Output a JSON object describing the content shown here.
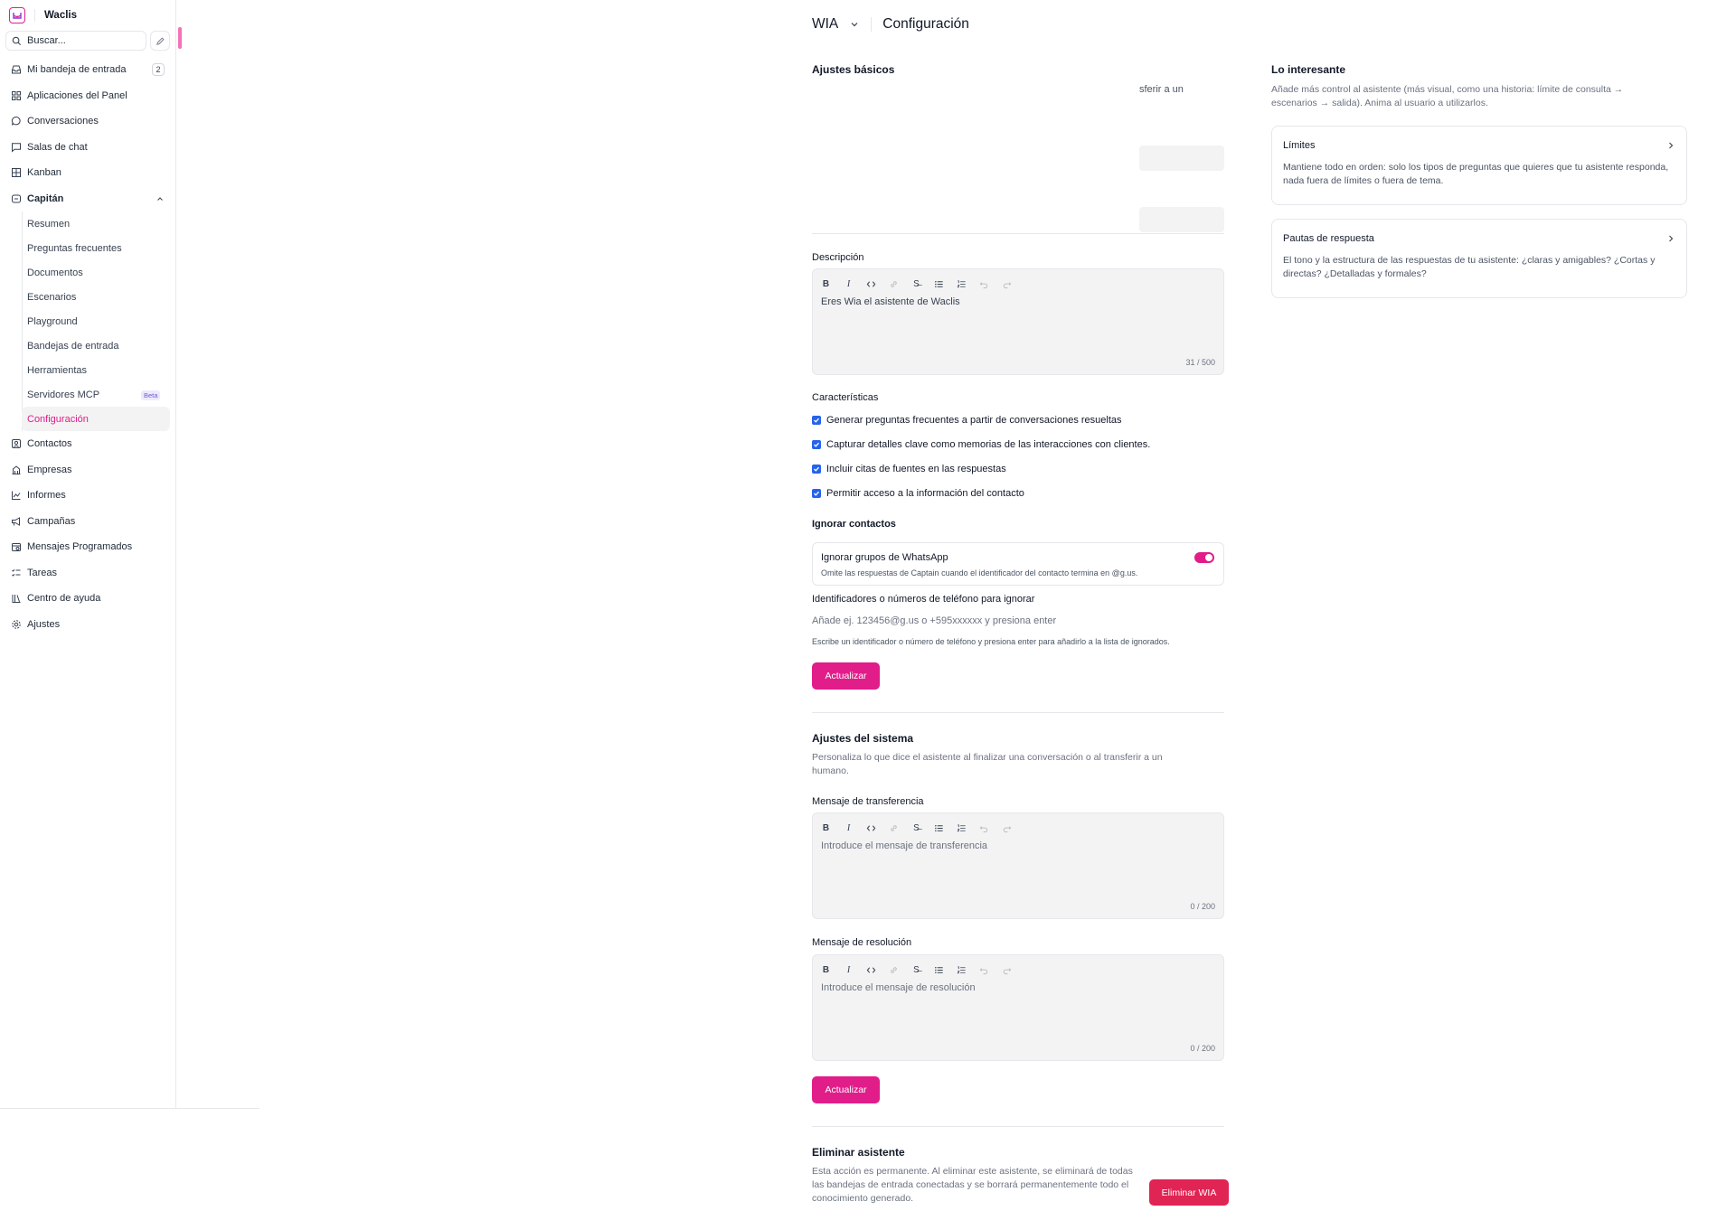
{
  "sidebar": {
    "account": "Waclis",
    "search_placeholder": "Buscar...",
    "nav": [
      {
        "label": "Mi bandeja de entrada",
        "icon": "inbox-icon",
        "badge": "2"
      },
      {
        "label": "Aplicaciones del Panel",
        "icon": "apps-icon"
      },
      {
        "label": "Conversaciones",
        "icon": "chat-bubble-icon"
      },
      {
        "label": "Salas de chat",
        "icon": "chat-square-icon"
      },
      {
        "label": "Kanban",
        "icon": "kanban-icon"
      },
      {
        "label": "Capitán",
        "icon": "captain-icon"
      }
    ],
    "captain_sub": [
      {
        "label": "Resumen"
      },
      {
        "label": "Preguntas frecuentes"
      },
      {
        "label": "Documentos"
      },
      {
        "label": "Escenarios"
      },
      {
        "label": "Playground"
      },
      {
        "label": "Bandejas de entrada"
      },
      {
        "label": "Herramientas"
      },
      {
        "label": "Servidores MCP",
        "badge": "Beta"
      },
      {
        "label": "Configuración",
        "active": true
      }
    ],
    "nav_bottom": [
      {
        "label": "Contactos",
        "icon": "contacts-icon"
      },
      {
        "label": "Empresas",
        "icon": "building-icon"
      },
      {
        "label": "Informes",
        "icon": "chart-icon"
      },
      {
        "label": "Campañas",
        "icon": "megaphone-icon"
      },
      {
        "label": "Mensajes Programados",
        "icon": "calendar-icon"
      },
      {
        "label": "Tareas",
        "icon": "tasks-icon"
      },
      {
        "label": "Centro de ayuda",
        "icon": "library-icon"
      },
      {
        "label": "Ajustes",
        "icon": "gear-icon"
      }
    ]
  },
  "header": {
    "assistant": "WIA",
    "title": "Configuración"
  },
  "basic": {
    "title": "Ajustes básicos",
    "stub_text": "sferir a un",
    "description_label": "Descripción",
    "description_value": "Eres Wia el asistente de Waclis",
    "description_count": "31 / 500"
  },
  "features": {
    "title": "Características",
    "items": [
      {
        "label": "Generar preguntas frecuentes a partir de conversaciones resueltas",
        "checked": true
      },
      {
        "label": "Capturar detalles clave como memorias de las interacciones con clientes.",
        "checked": true
      },
      {
        "label": "Incluir citas de fuentes en las respuestas",
        "checked": true
      },
      {
        "label": "Permitir acceso a la información del contacto",
        "checked": true
      }
    ]
  },
  "ignore": {
    "title": "Ignorar contactos",
    "toggle_title": "Ignorar grupos de WhatsApp",
    "toggle_desc": "Omite las respuestas de Captain cuando el identificador del contacto termina en @g.us.",
    "toggle_on": true,
    "ids_label": "Identificadores o números de teléfono para ignorar",
    "ids_placeholder": "Añade ej. 123456@g.us o +595xxxxxx y presiona enter",
    "ids_hint": "Escribe un identificador o número de teléfono y presiona enter para añadirlo a la lista de ignorados.",
    "update_label": "Actualizar"
  },
  "system": {
    "title": "Ajustes del sistema",
    "subtitle": "Personaliza lo que dice el asistente al finalizar una conversación o al transferir a un humano.",
    "handoff_label": "Mensaje de transferencia",
    "handoff_placeholder": "Introduce el mensaje de transferencia",
    "handoff_count": "0 / 200",
    "resolution_label": "Mensaje de resolución",
    "resolution_placeholder": "Introduce el mensaje de resolución",
    "resolution_count": "0 / 200",
    "update_label": "Actualizar"
  },
  "delete": {
    "title": "Eliminar asistente",
    "description": "Esta acción es permanente. Al eliminar este asistente, se eliminará de todas las bandejas de entrada conectadas y se borrará permanentemente todo el conocimiento generado.",
    "button_label": "Eliminar WIA"
  },
  "right": {
    "title": "Lo interesante",
    "subtitle": "Añade más control al asistente (más visual, como una historia: límite de consulta → escenarios → salida). Anima al usuario a utilizarlos.",
    "cards": [
      {
        "title": "Límites",
        "description": "Mantiene todo en orden: solo los tipos de preguntas que quieres que tu asistente responda, nada fuera de límites o fuera de tema."
      },
      {
        "title": "Pautas de respuesta",
        "description": "El tono y la estructura de las respuestas de tu asistente: ¿claras y amigables? ¿Cortas y directas? ¿Detalladas y formales?"
      }
    ]
  },
  "colors": {
    "accent": "#e11d8a",
    "danger": "#e02454",
    "checkbox": "#2563eb"
  }
}
